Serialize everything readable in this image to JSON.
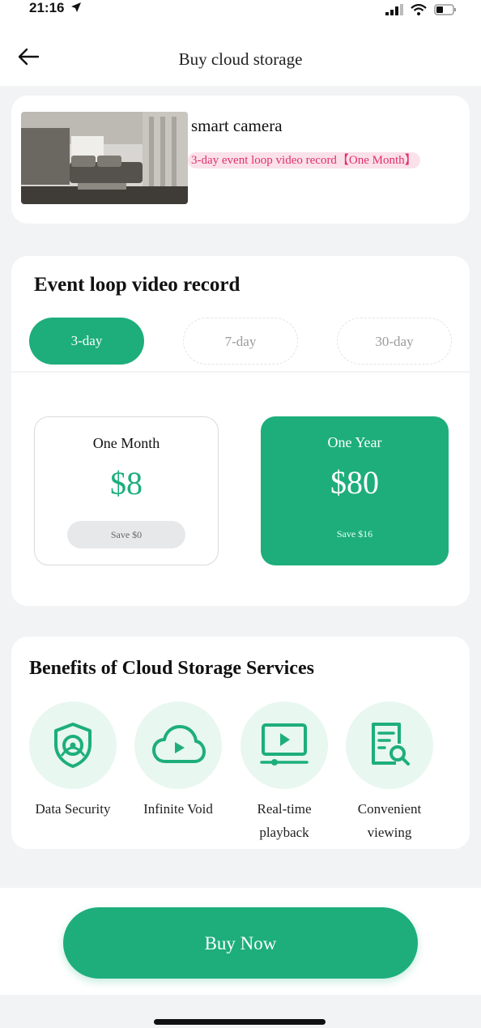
{
  "status_bar": {
    "time": "21:16"
  },
  "header": {
    "title": "Buy cloud storage"
  },
  "product": {
    "name": "smart camera",
    "tag": "3-day event loop video record【One Month】"
  },
  "plan_section": {
    "title": "Event loop video record",
    "tabs": [
      {
        "label": "3-day",
        "active": true
      },
      {
        "label": "7-day",
        "active": false
      },
      {
        "label": "30-day",
        "active": false
      }
    ],
    "plans": [
      {
        "label": "One Month",
        "price": "$8",
        "note": "Save $0",
        "selected": false
      },
      {
        "label": "One Year",
        "price": "$80",
        "note": "Save $16",
        "selected": true
      }
    ]
  },
  "benefits": {
    "title": "Benefits of Cloud Storage Services",
    "items": [
      {
        "label": "Data Security",
        "icon": "shield-icon"
      },
      {
        "label": "Infinite Void",
        "icon": "cloud-play-icon"
      },
      {
        "label": "Real-time playback",
        "icon": "playback-screen-icon"
      },
      {
        "label": "Convenient viewing",
        "icon": "document-search-icon"
      }
    ]
  },
  "cta": {
    "label": "Buy Now"
  },
  "colors": {
    "accent": "#1dae7c",
    "tag_text": "#e0306a",
    "tag_bg": "#fbe1ea"
  }
}
